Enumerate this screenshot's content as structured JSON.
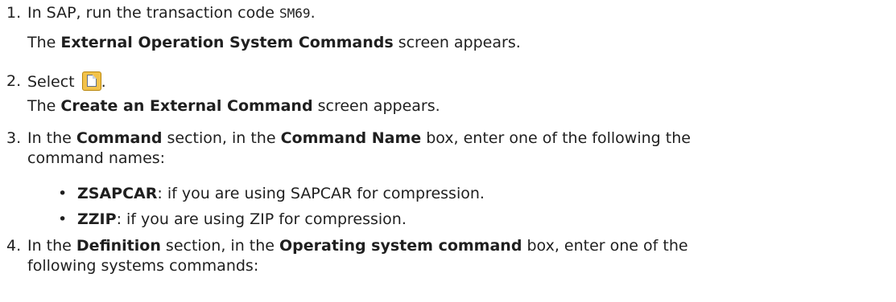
{
  "steps": [
    {
      "num": "1.",
      "parts": [
        "In SAP, run the transaction code ",
        "SM69",
        "."
      ],
      "result_parts": [
        "The ",
        "External Operation System Commands",
        " screen appears."
      ]
    },
    {
      "num": "2.",
      "parts": [
        "Select ",
        "."
      ],
      "icon": "new-document-icon",
      "result_parts": [
        "The ",
        "Create an External Command",
        " screen appears."
      ]
    },
    {
      "num": "3.",
      "parts": [
        "In the ",
        "Command",
        " section, in the ",
        "Command Name",
        " box, enter one of the following the"
      ],
      "cont": "command names:",
      "bullets": [
        {
          "term": "ZSAPCAR",
          "rest": ": if you are using SAPCAR for compression."
        },
        {
          "term": "ZZIP",
          "rest": ": if you are using ZIP for compression."
        }
      ]
    },
    {
      "num": "4.",
      "parts": [
        "In the ",
        "Definition",
        " section, in the ",
        "Operating system command",
        " box, enter one of the"
      ],
      "cont": "following systems commands:"
    }
  ]
}
